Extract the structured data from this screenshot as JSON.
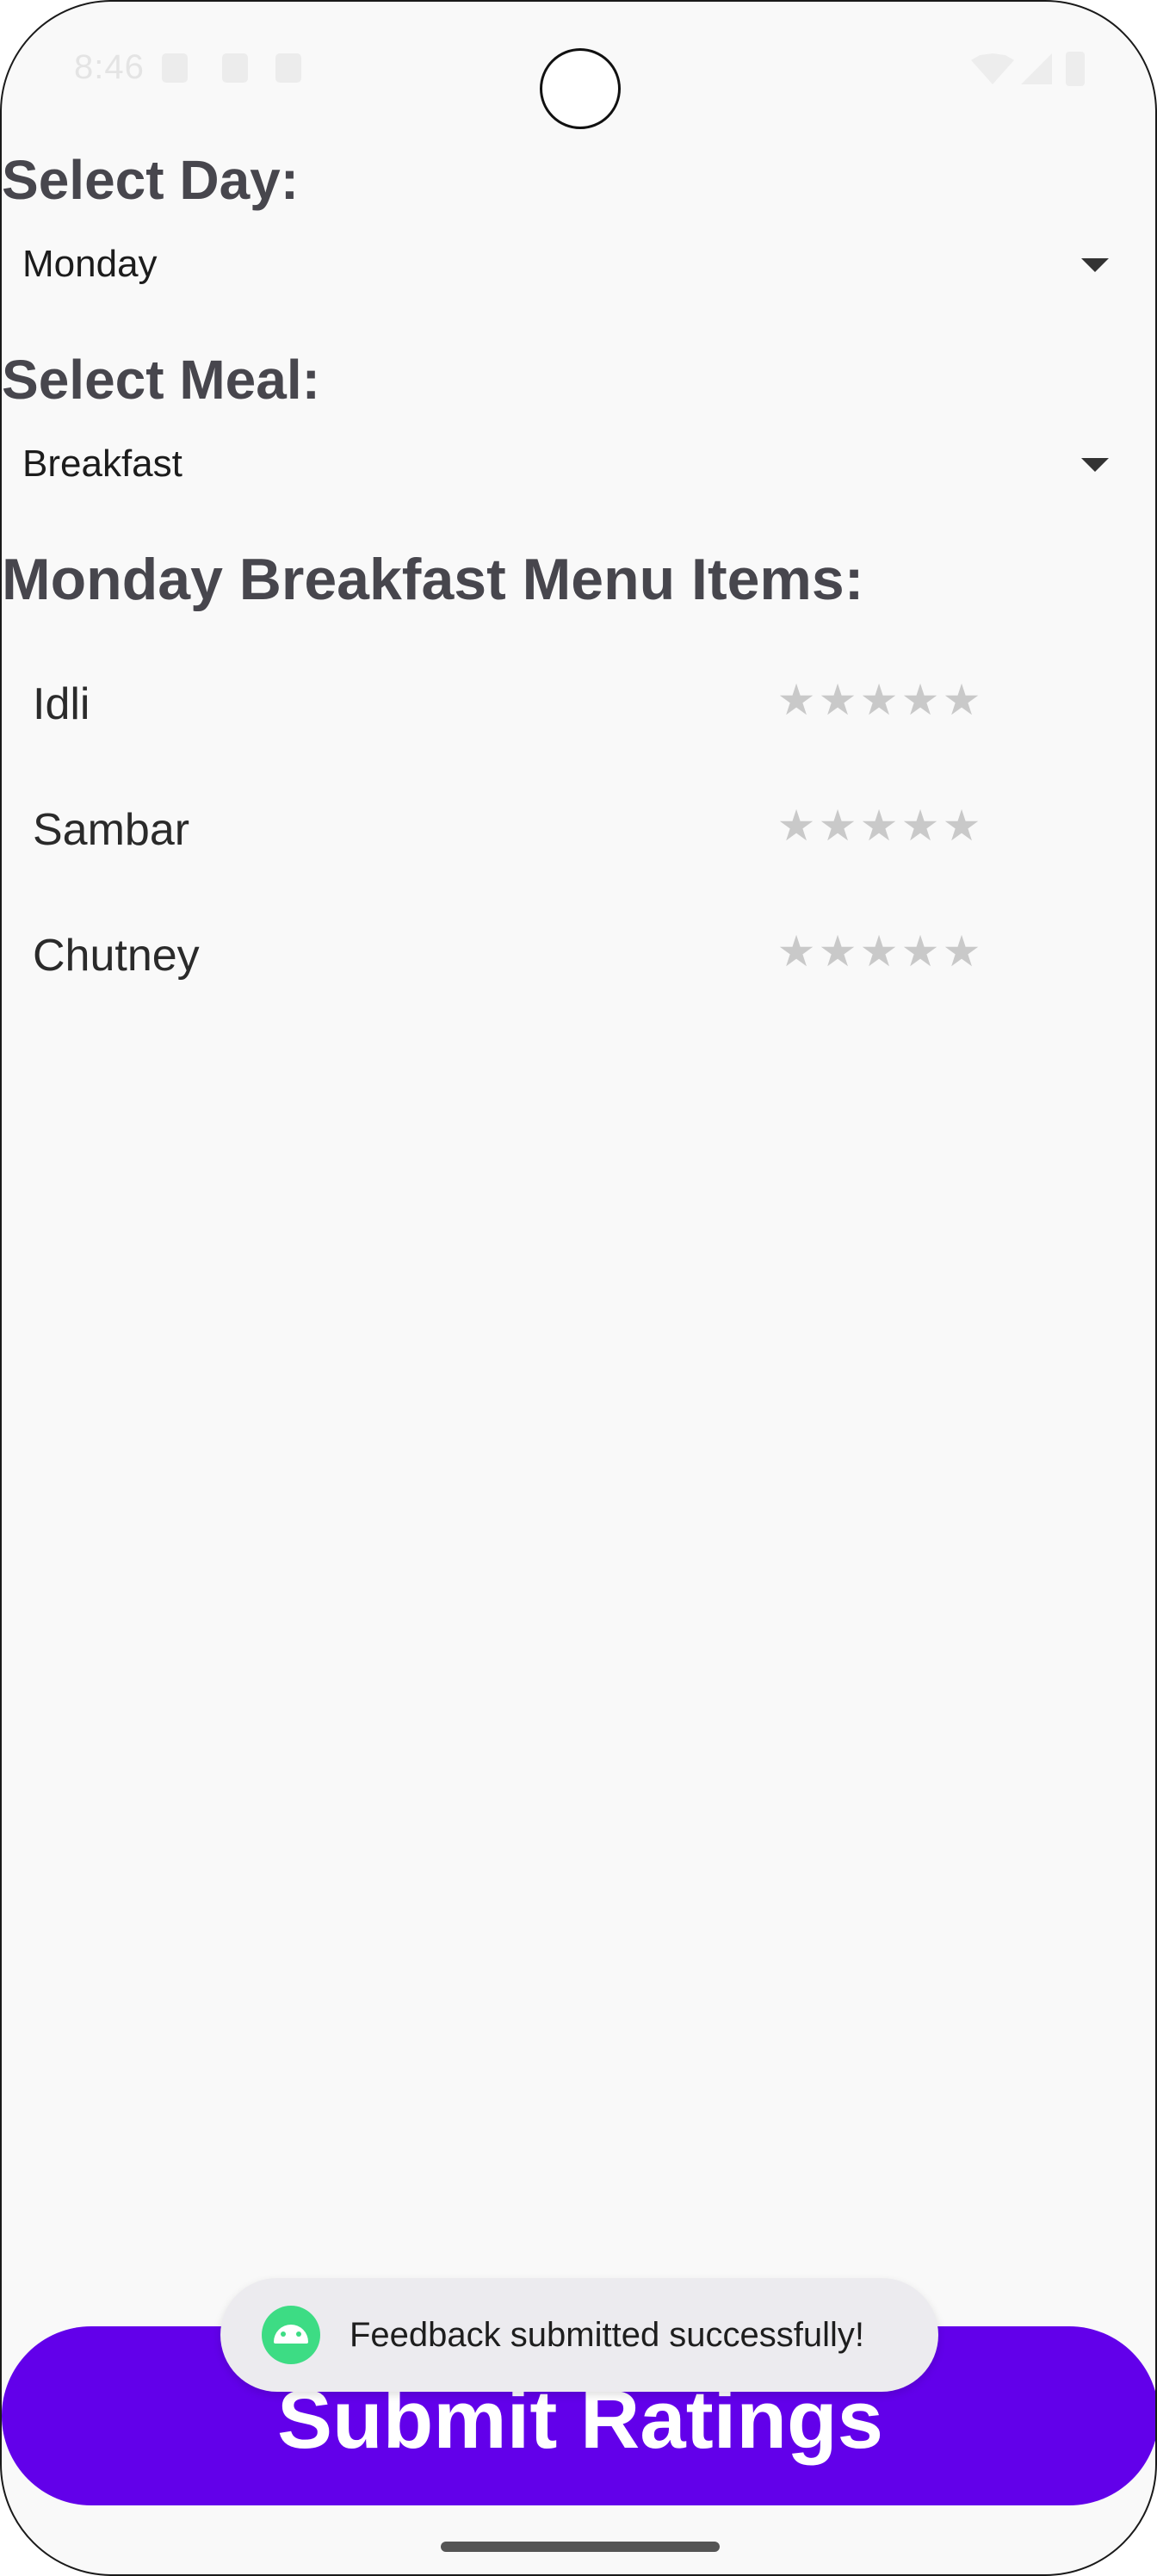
{
  "status_bar": {
    "time": "8:46"
  },
  "day_selector": {
    "label": "Select Day:",
    "value": "Monday"
  },
  "meal_selector": {
    "label": "Select Meal:",
    "value": "Breakfast"
  },
  "menu": {
    "title": "Monday Breakfast Menu Items:",
    "items": [
      {
        "name": "Idli",
        "rating": 0,
        "max_rating": 5
      },
      {
        "name": "Sambar",
        "rating": 0,
        "max_rating": 5
      },
      {
        "name": "Chutney",
        "rating": 0,
        "max_rating": 5
      }
    ],
    "star_glyph": "★"
  },
  "submit": {
    "label": "Submit Ratings"
  },
  "toast": {
    "icon": "android-icon",
    "message": "Feedback submitted successfully!"
  },
  "colors": {
    "accent": "#6200ea",
    "label": "#47464d",
    "star_empty": "#c9c9c9",
    "toast_bg": "#ecebef"
  }
}
